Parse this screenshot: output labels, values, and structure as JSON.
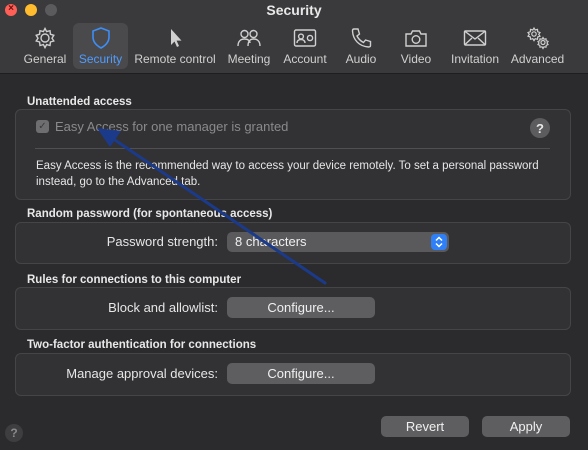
{
  "window": {
    "title": "Security"
  },
  "toolbar": {
    "tabs": [
      {
        "label": "General",
        "icon": "gear-icon"
      },
      {
        "label": "Security",
        "icon": "shield-icon",
        "active": true
      },
      {
        "label": "Remote control",
        "icon": "pointer-icon"
      },
      {
        "label": "Meeting",
        "icon": "people-icon"
      },
      {
        "label": "Account",
        "icon": "id-card-icon"
      },
      {
        "label": "Audio",
        "icon": "phone-icon"
      },
      {
        "label": "Video",
        "icon": "camera-icon"
      },
      {
        "label": "Invitation",
        "icon": "envelope-icon"
      },
      {
        "label": "Advanced",
        "icon": "gears-icon"
      }
    ]
  },
  "unattended": {
    "heading": "Unattended access",
    "checkbox_label": "Easy Access for one manager is granted",
    "checkbox_checked": true,
    "help": "?",
    "description": "Easy Access is the recommended way to access your device remotely. To set a personal password instead, go to the Advanced tab."
  },
  "random_password": {
    "heading": "Random password (for spontaneous access)",
    "strength_label": "Password strength:",
    "strength_value": "8 characters"
  },
  "rules": {
    "heading": "Rules for connections to this computer",
    "block_label": "Block and allowlist:",
    "configure_label": "Configure..."
  },
  "two_factor": {
    "heading": "Two-factor authentication for connections",
    "manage_label": "Manage approval devices:",
    "configure_label": "Configure..."
  },
  "footer": {
    "revert_label": "Revert",
    "apply_label": "Apply",
    "help": "?"
  },
  "colors": {
    "accent": "#3d8ef7",
    "annotation_arrow": "#1c3a8a",
    "background": "#2b2b2e"
  }
}
